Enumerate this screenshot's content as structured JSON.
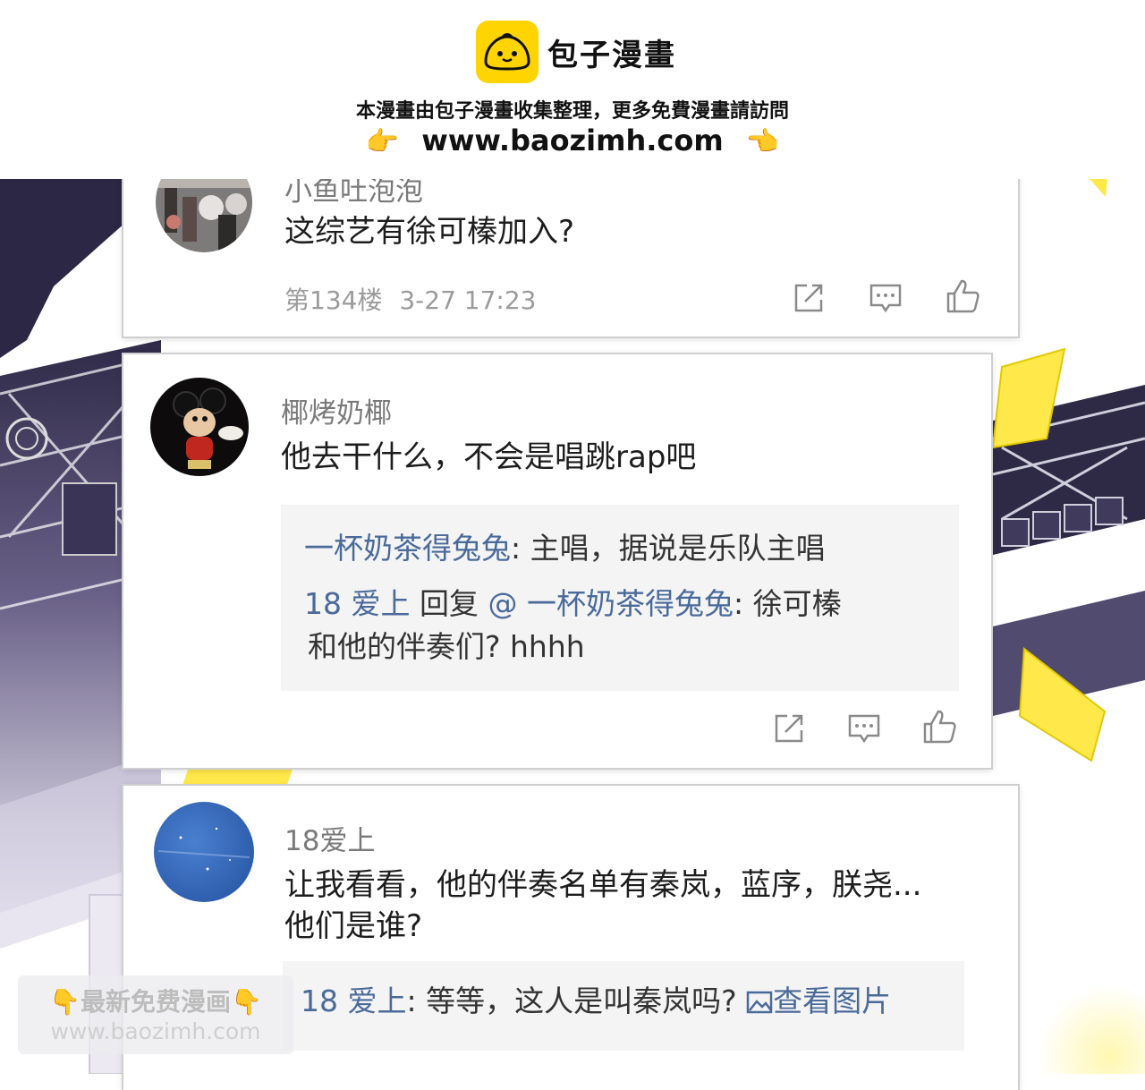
{
  "header": {
    "brand_name": "包子漫畫",
    "notice": "本漫畫由包子漫畫收集整理，更多免費漫畫請訪問",
    "url": "www.baozimh.com",
    "pointer_emoji": "👉",
    "pointer_back_emoji": "👈",
    "logo_color": "#ffd400"
  },
  "comments": [
    {
      "username": "小鱼吐泡泡",
      "text": "这综艺有徐可榛加入?",
      "floor": "第134楼",
      "time": "3-27 17:23"
    },
    {
      "username": "椰烤奶椰",
      "text": "他去干什么，不会是唱跳rap吧",
      "replies": [
        {
          "author": "一杯奶茶得兔兔",
          "sep": ":",
          "body": " 主唱，据说是乐队主唱"
        },
        {
          "author": "18 爱上",
          "reply_word": " 回复 ",
          "mention": "@ 一杯奶茶得兔兔",
          "sep": ":",
          "body": " 徐可榛",
          "body2": "和他的伴奏们? hhhh"
        }
      ]
    },
    {
      "username": "18爱上",
      "text": "让我看看，他的伴奏名单有秦岚，蓝序，朕尧...",
      "text2": "他们是谁?",
      "replies": [
        {
          "author": "18 爱上",
          "sep": ":",
          "body": " 等等，这人是叫秦岚吗?",
          "link": "查看图片"
        }
      ]
    }
  ],
  "watermark": {
    "line1": "最新免费漫画",
    "line2": "www.baozimh.com",
    "emoji": "👇"
  },
  "colors": {
    "link_blue": "#4a6a99",
    "reply_bg": "#f4f4f5",
    "night_purple": "#3a3556",
    "accent_yellow": "#ffe94a"
  },
  "icons": [
    "share-icon",
    "comment-icon",
    "thumbs-up-icon",
    "image-icon",
    "finger-pointing-right-icon",
    "finger-pointing-down-icon"
  ]
}
